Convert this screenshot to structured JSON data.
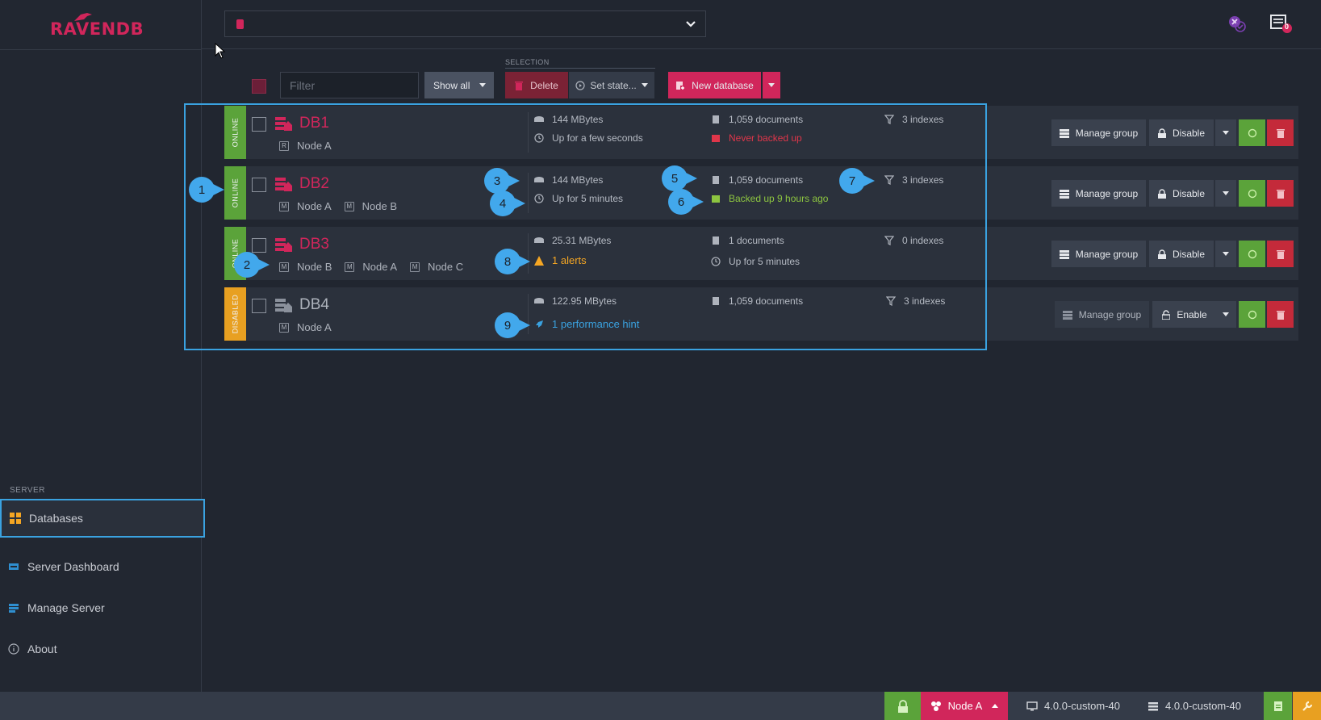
{
  "brand": {
    "logo_text": "RAVENDB"
  },
  "sidebar": {
    "section_label": "SERVER",
    "items": [
      {
        "label": "Databases",
        "active": true
      },
      {
        "label": "Server Dashboard"
      },
      {
        "label": "Manage Server"
      },
      {
        "label": "About"
      }
    ]
  },
  "topbar": {
    "db_selector_value": "",
    "notifications_count": "0"
  },
  "toolbar": {
    "filter_placeholder": "Filter",
    "show_all_label": "Show all",
    "selection_label": "SELECTION",
    "delete_label": "Delete",
    "set_state_label": "Set state...",
    "new_database_label": "New database"
  },
  "databases": [
    {
      "state": "ONLINE",
      "name": "DB1",
      "nodes": [
        {
          "badge": "R",
          "name": "Node A"
        }
      ],
      "size": "144 MBytes",
      "uptime": "Up for a few seconds",
      "documents": "1,059 documents",
      "backup": "Never backed up",
      "indexes": "3 indexes",
      "actions": {
        "manage": "Manage group",
        "toggle": "Disable"
      }
    },
    {
      "state": "ONLINE",
      "name": "DB2",
      "nodes": [
        {
          "badge": "M",
          "name": "Node A"
        },
        {
          "badge": "M",
          "name": "Node B"
        }
      ],
      "size": "144 MBytes",
      "uptime": "Up for 5 minutes",
      "documents": "1,059 documents",
      "backup": "Backed up 9 hours ago",
      "indexes": "3 indexes",
      "actions": {
        "manage": "Manage group",
        "toggle": "Disable"
      }
    },
    {
      "state": "ONLINE",
      "name": "DB3",
      "nodes": [
        {
          "badge": "M",
          "name": "Node B"
        },
        {
          "badge": "M",
          "name": "Node A"
        },
        {
          "badge": "M",
          "name": "Node C"
        }
      ],
      "size": "25.31 MBytes",
      "alerts": "1 alerts",
      "documents": "1 documents",
      "uptime": "Up for 5 minutes",
      "indexes": "0 indexes",
      "actions": {
        "manage": "Manage group",
        "toggle": "Disable"
      }
    },
    {
      "state": "DISABLED",
      "name": "DB4",
      "nodes": [
        {
          "badge": "M",
          "name": "Node A"
        }
      ],
      "size": "122.95 MBytes",
      "hint": "1 performance hint",
      "documents": "1,059 documents",
      "indexes": "3 indexes",
      "actions": {
        "manage": "Manage group",
        "toggle": "Enable"
      }
    }
  ],
  "callouts": [
    "1",
    "2",
    "3",
    "4",
    "5",
    "6",
    "7",
    "8",
    "9"
  ],
  "footer": {
    "node_label": "Node A",
    "client_version": "4.0.0-custom-40",
    "server_version": "4.0.0-custom-40"
  },
  "colors": {
    "brand": "#d1265b",
    "online": "#5ba33a",
    "disabled": "#e8a021",
    "highlight": "#3aa2e0"
  }
}
